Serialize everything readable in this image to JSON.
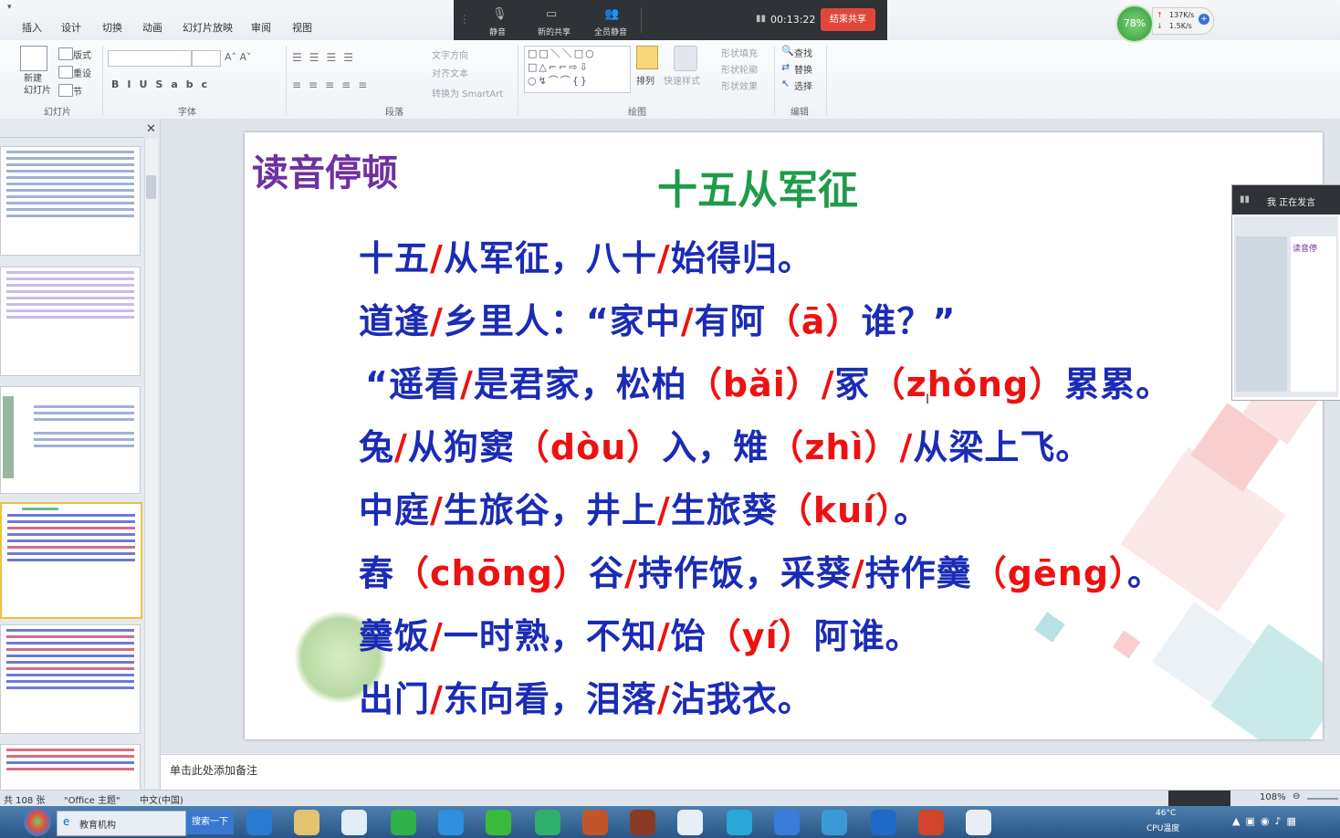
{
  "ribbon": {
    "tabs": [
      "插入",
      "设计",
      "切换",
      "动画",
      "幻灯片放映",
      "审阅",
      "视图"
    ],
    "groups": {
      "slides": {
        "label": "幻灯片",
        "new_slide": "新建\n幻灯片",
        "layout": "版式",
        "reset": "重设",
        "section": "节"
      },
      "font": {
        "label": "字体"
      },
      "paragraph": {
        "label": "段落",
        "text_direction": "文字方向",
        "align_text": "对齐文本",
        "smartart": "转换为 SmartArt"
      },
      "drawing": {
        "label": "绘图",
        "arrange": "排列",
        "quick_styles": "快速样式",
        "shape_fill": "形状填充",
        "shape_outline": "形状轮廓",
        "shape_effects": "形状效果"
      },
      "editing": {
        "label": "编辑",
        "find": "查找",
        "replace": "替换",
        "select": "选择"
      }
    }
  },
  "share_toolbar": {
    "mute": "静音",
    "new_share": "新的共享",
    "mute_all": "全员静音",
    "timer": "00:13:22",
    "stop": "结束共享"
  },
  "cpu_widget": {
    "percent": "78%",
    "up": "137K/s",
    "down": "1.5K/s"
  },
  "slide": {
    "heading": "读音停顿",
    "poem_title": "十五从军征",
    "lines": [
      [
        [
          "b",
          "十五"
        ],
        [
          "r",
          "/"
        ],
        [
          "b",
          "从军征，八十"
        ],
        [
          "r",
          "/"
        ],
        [
          "b",
          "始得归。"
        ]
      ],
      [
        [
          "b",
          "道逢"
        ],
        [
          "r",
          "/"
        ],
        [
          "b",
          "乡里人：“家中"
        ],
        [
          "r",
          "/"
        ],
        [
          "b",
          "有阿"
        ],
        [
          "r",
          "（ā）"
        ],
        [
          "b",
          "谁？”"
        ]
      ],
      [
        [
          "b",
          "“遥看"
        ],
        [
          "r",
          "/"
        ],
        [
          "b",
          "是君家，松柏"
        ],
        [
          "r",
          "（bǎi）/"
        ],
        [
          "b",
          "冢"
        ],
        [
          "r",
          "（zhǒng）"
        ],
        [
          "b",
          "累累。"
        ]
      ],
      [
        [
          "b",
          "兔"
        ],
        [
          "r",
          "/"
        ],
        [
          "b",
          "从狗窦"
        ],
        [
          "r",
          "（dòu）"
        ],
        [
          "b",
          "入，雉"
        ],
        [
          "r",
          "（zhì）/"
        ],
        [
          "b",
          "从梁上飞。"
        ]
      ],
      [
        [
          "b",
          "中庭"
        ],
        [
          "r",
          "/"
        ],
        [
          "b",
          "生旅谷，井上"
        ],
        [
          "r",
          "/"
        ],
        [
          "b",
          "生旅葵"
        ],
        [
          "r",
          "（kuí）"
        ],
        [
          "b",
          "。"
        ]
      ],
      [
        [
          "b",
          "舂"
        ],
        [
          "r",
          "（chōng）"
        ],
        [
          "b",
          "谷"
        ],
        [
          "r",
          "/"
        ],
        [
          "b",
          "持作饭，采葵"
        ],
        [
          "r",
          "/"
        ],
        [
          "b",
          "持作羹"
        ],
        [
          "r",
          "（gēng）"
        ],
        [
          "b",
          "。"
        ]
      ],
      [
        [
          "b",
          "羹饭"
        ],
        [
          "r",
          "/"
        ],
        [
          "b",
          "一时熟，不知"
        ],
        [
          "r",
          "/"
        ],
        [
          "b",
          "饴"
        ],
        [
          "r",
          "（yí）"
        ],
        [
          "b",
          "阿谁。"
        ]
      ],
      [
        [
          "b",
          "出门"
        ],
        [
          "r",
          "/"
        ],
        [
          "b",
          "东向看，泪落"
        ],
        [
          "r",
          "/"
        ],
        [
          "b",
          "沾我衣。"
        ]
      ]
    ]
  },
  "viewer": {
    "label": "我 正在发言",
    "mini_heading": "读音停"
  },
  "notes": {
    "placeholder": "单击此处添加备注"
  },
  "status": {
    "slide_count": "共 108 张",
    "theme": "\"Office 主题\"",
    "language": "中文(中国)",
    "zoom": "108%"
  },
  "taskbar": {
    "browser_tab": "教育机构",
    "search": "搜索一下",
    "temp": "46°C",
    "temp_label": "CPU温度"
  },
  "colors": {
    "heading": "#7030a0",
    "title": "#1f9b4a",
    "poem": "#1a2cb5",
    "pinyin": "#e11111"
  }
}
